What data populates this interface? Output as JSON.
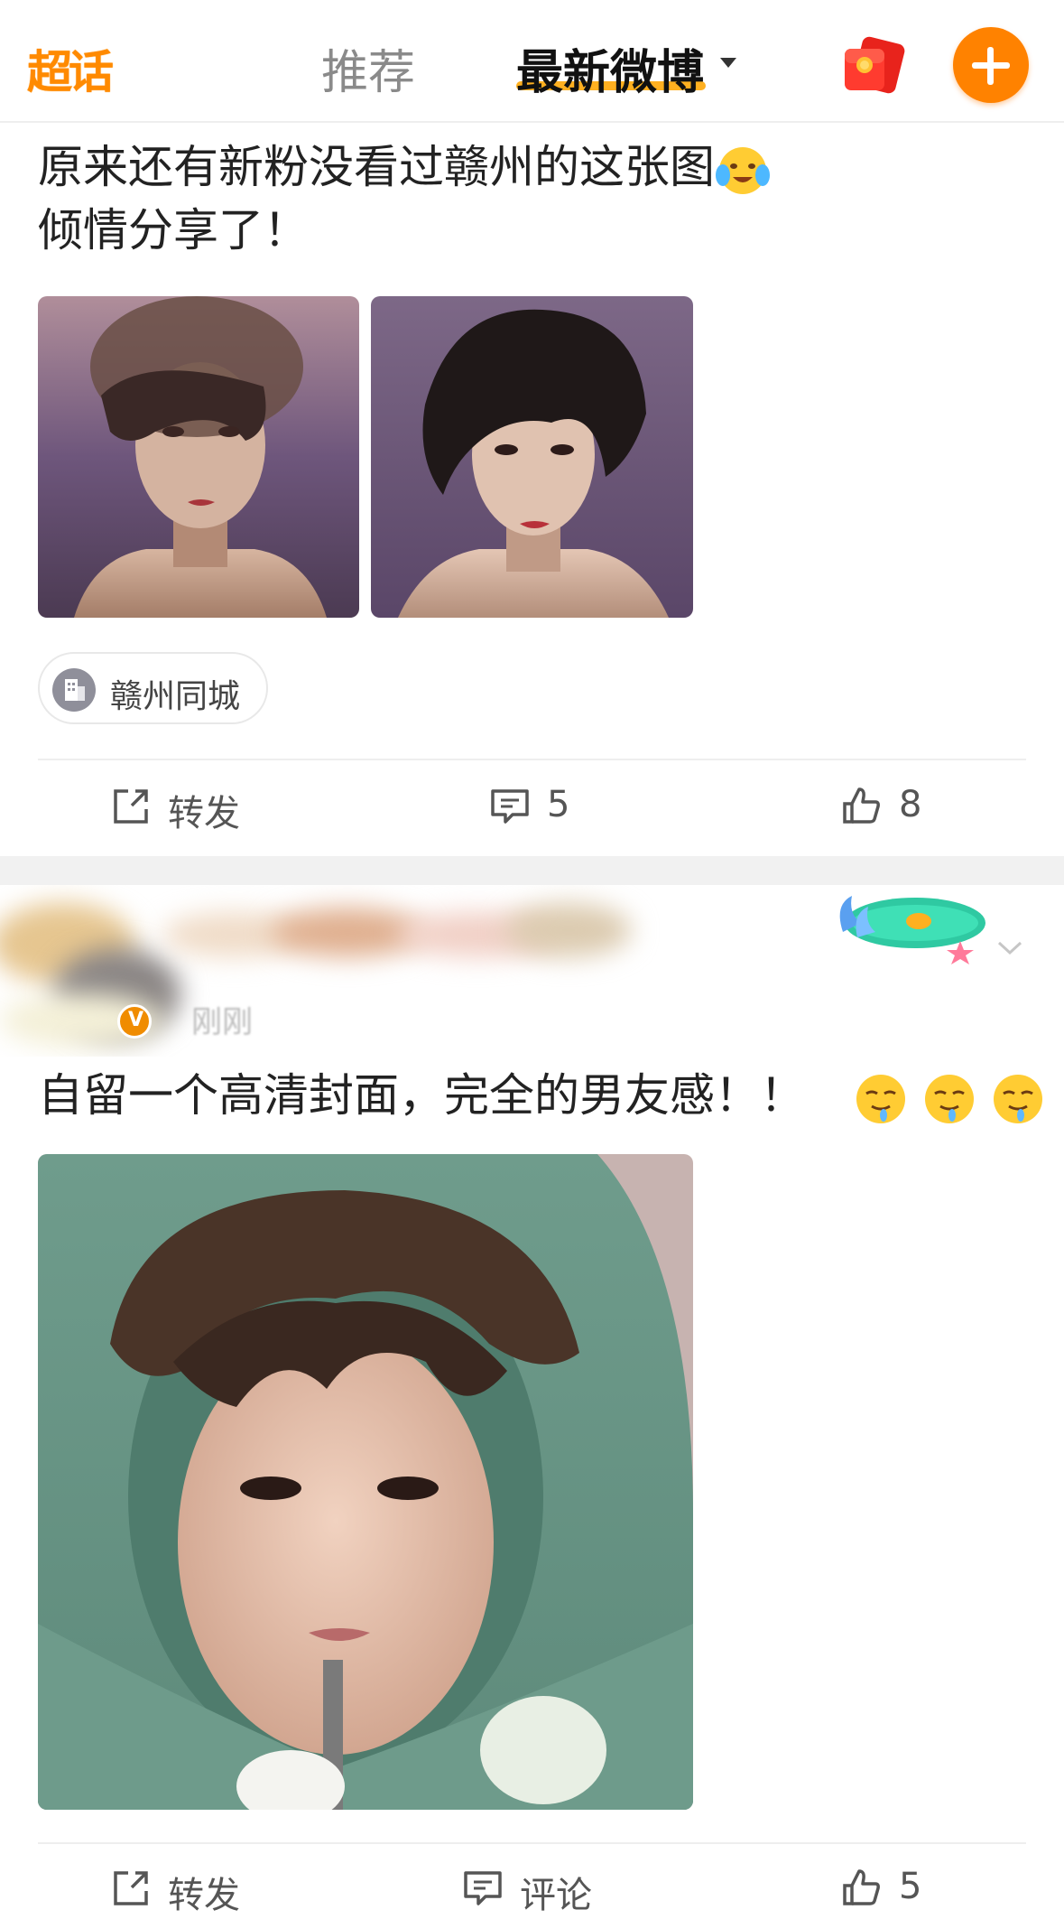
{
  "nav": {
    "logo_text": "超话",
    "tabs": [
      {
        "label": "推荐",
        "active": false
      },
      {
        "label": "最新微博",
        "active": true
      }
    ],
    "icons": [
      "red-packet-icon",
      "plus-icon"
    ],
    "accent_color": "#ff8200"
  },
  "posts": [
    {
      "text_lines": [
        "原来还有新粉没看过赣州的这张图",
        "倾情分享了！"
      ],
      "emoji": "crying-laughing-emoji",
      "images": [
        "portrait-photo-1",
        "portrait-photo-2"
      ],
      "location": "赣州同城",
      "actions": {
        "repost": "转发",
        "comments": "5",
        "likes": "8"
      }
    },
    {
      "time": "刚刚",
      "text": "自留一个高清封面，完全的男友感！！",
      "emojis": [
        "drooling-emoji",
        "drooling-emoji",
        "drooling-emoji"
      ],
      "images": [
        "hoodie-selfie-photo"
      ],
      "actions": {
        "repost": "转发",
        "comments": "评论",
        "likes": "5"
      }
    }
  ]
}
